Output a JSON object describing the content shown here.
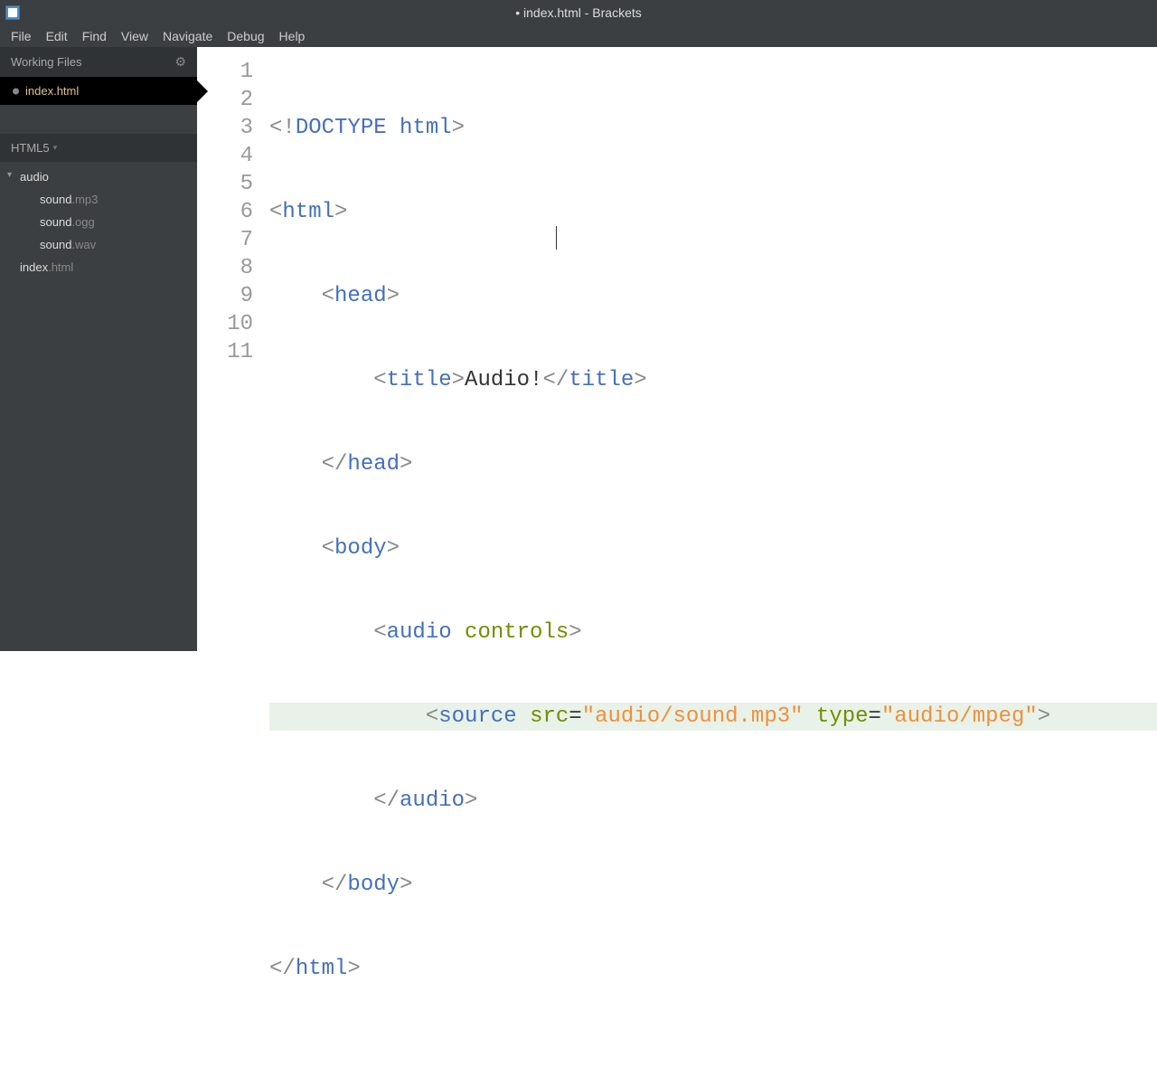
{
  "titlebar": {
    "title": "• index.html - Brackets"
  },
  "menubar": {
    "items": [
      "File",
      "Edit",
      "Find",
      "View",
      "Navigate",
      "Debug",
      "Help"
    ]
  },
  "sidebar": {
    "working_files_label": "Working Files",
    "working_file": "index.html",
    "project_label": "HTML5",
    "tree": {
      "folder": "audio",
      "children": [
        {
          "name": "sound",
          "ext": ".mp3"
        },
        {
          "name": "sound",
          "ext": ".ogg"
        },
        {
          "name": "sound",
          "ext": ".wav"
        }
      ],
      "root_file": {
        "name": "index",
        "ext": ".html"
      }
    }
  },
  "editor": {
    "line_numbers": [
      "1",
      "2",
      "3",
      "4",
      "5",
      "6",
      "7",
      "8",
      "9",
      "10",
      "11"
    ],
    "highlighted_line": 8,
    "code": {
      "l1": {
        "full": "<!DOCTYPE html>"
      },
      "l2": {
        "open": "<",
        "tag": "html",
        "close": ">"
      },
      "l3": {
        "indent": "    ",
        "open": "<",
        "tag": "head",
        "close": ">"
      },
      "l4": {
        "indent": "        ",
        "open": "<",
        "tag": "title",
        "close": ">",
        "text": "Audio!",
        "open2": "</",
        "tag2": "title",
        "close2": ">"
      },
      "l5": {
        "indent": "    ",
        "open": "</",
        "tag": "head",
        "close": ">"
      },
      "l6": {
        "indent": "    ",
        "open": "<",
        "tag": "body",
        "close": ">"
      },
      "l7": {
        "indent": "        ",
        "open": "<",
        "tag": "audio",
        "sp": " ",
        "attr": "controls",
        "close": ">"
      },
      "l8": {
        "indent": "            ",
        "open": "<",
        "tag": "source",
        "sp1": " ",
        "attr1": "src",
        "eq1": "=",
        "str1": "\"audio/sound.mp3\"",
        "sp2": " ",
        "attr2": "type",
        "eq2": "=",
        "str2": "\"audio/mpeg\"",
        "close": ">"
      },
      "l9": {
        "indent": "        ",
        "open": "</",
        "tag": "audio",
        "close": ">"
      },
      "l10": {
        "indent": "    ",
        "open": "</",
        "tag": "body",
        "close": ">"
      },
      "l11": {
        "open": "</",
        "tag": "html",
        "close": ">"
      }
    }
  }
}
